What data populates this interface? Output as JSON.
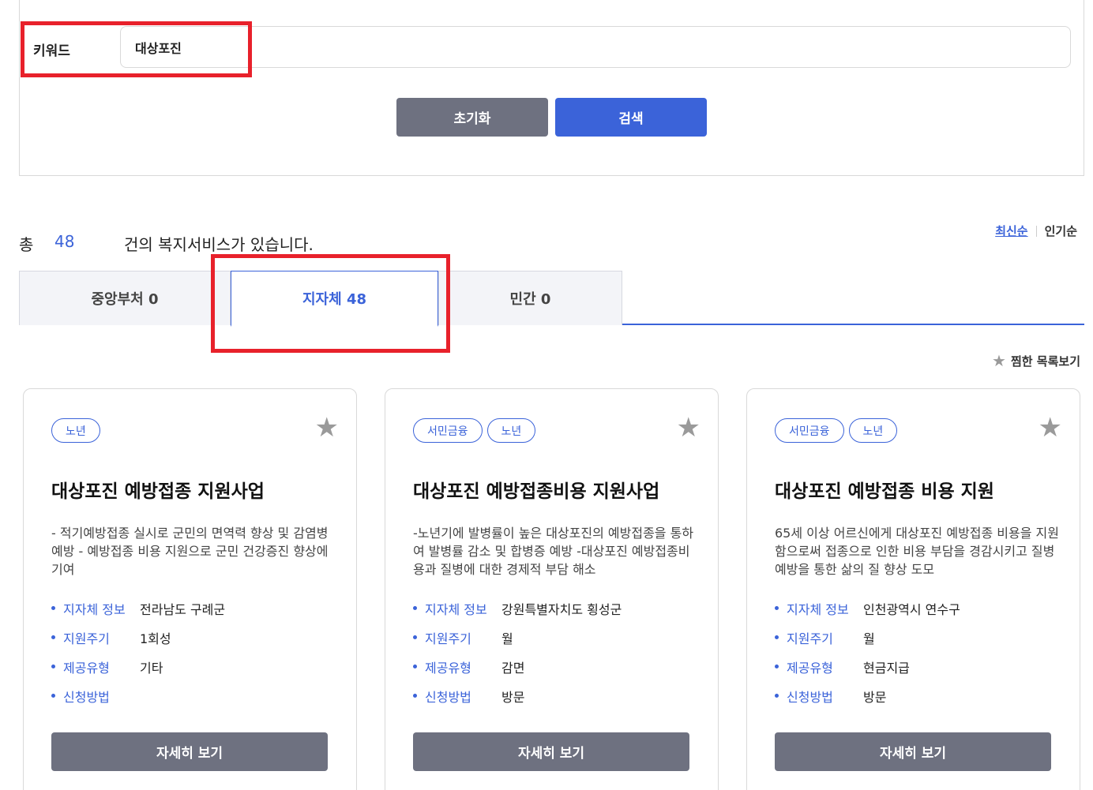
{
  "search": {
    "keyword_label": "키워드",
    "keyword_value": "대상포진",
    "reset_label": "초기화",
    "search_label": "검색"
  },
  "results": {
    "prefix": "총",
    "count": "48",
    "suffix": "건의 복지서비스가 있습니다."
  },
  "sort": {
    "latest": "최신순",
    "popular": "인기순"
  },
  "tabs": [
    {
      "label": "중앙부처 0"
    },
    {
      "label": "지자체 48"
    },
    {
      "label": "민간 0"
    }
  ],
  "favorites_link": "찜한 목록보기",
  "info_labels": {
    "region": "지자체 정보",
    "cycle": "지원주기",
    "type": "제공유형",
    "method": "신청방법"
  },
  "cards": [
    {
      "badges": [
        "노년"
      ],
      "title": "대상포진 예방접종 지원사업",
      "desc": "- 적기예방접종 실시로 군민의 면역력 향상 및 감염병 예방 - 예방접종 비용 지원으로 군민 건강증진 향상에 기여",
      "region": "전라남도 구례군",
      "cycle": "1회성",
      "type": "기타",
      "method": "",
      "button": "자세히 보기"
    },
    {
      "badges": [
        "서민금융",
        "노년"
      ],
      "title": "대상포진 예방접종비용 지원사업",
      "desc": "-노년기에 발병률이 높은 대상포진의 예방접종을 통하여 발병률 감소 및 합병증 예방 -대상포진 예방접종비용과 질병에 대한 경제적 부담 해소",
      "region": "강원특별자치도 횡성군",
      "cycle": "월",
      "type": "감면",
      "method": "방문",
      "button": "자세히 보기"
    },
    {
      "badges": [
        "서민금융",
        "노년"
      ],
      "title": "대상포진 예방접종 비용 지원",
      "desc": "65세 이상 어르신에게 대상포진 예방접종 비용을 지원함으로써 접종으로 인한 비용 부담을 경감시키고 질병 예방을 통한 삶의 질 향상 도모",
      "region": "인천광역시 연수구",
      "cycle": "월",
      "type": "현금지급",
      "method": "방문",
      "button": "자세히 보기"
    }
  ],
  "colors": {
    "accent": "#3b63d9",
    "highlight": "#e8212b",
    "button_gray": "#6e7180"
  }
}
